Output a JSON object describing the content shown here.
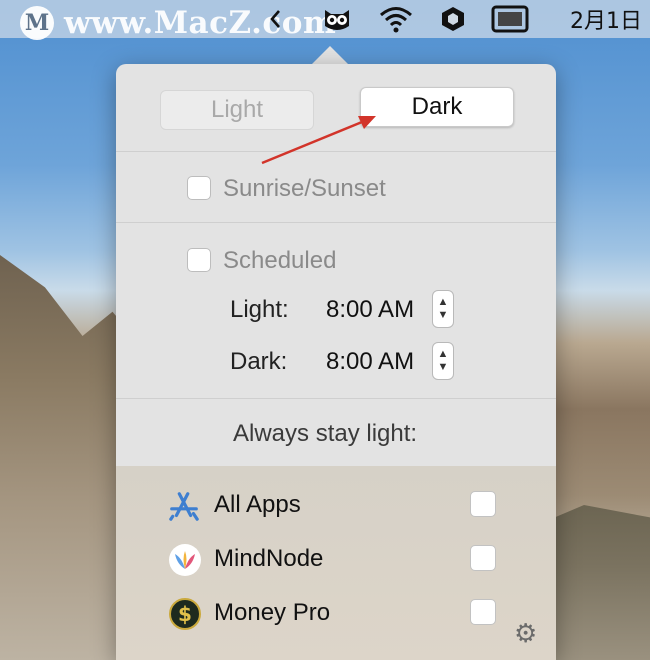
{
  "watermark": {
    "logo": "M",
    "text": "www.MacZ.com"
  },
  "menubar": {
    "icons": [
      "chevron-left-icon",
      "owl-icon",
      "wifi-icon",
      "hexagon-icon",
      "display-icon"
    ],
    "clock": "2月1日"
  },
  "popover": {
    "light_button": "Light",
    "dark_button": "Dark",
    "sunrise_label": "Sunrise/Sunset",
    "scheduled_label": "Scheduled",
    "light_time_label": "Light:",
    "light_time_value": "8:00 AM",
    "dark_time_label": "Dark:",
    "dark_time_value": "8:00 AM",
    "always_light_label": "Always stay light:",
    "apps": [
      {
        "name": "All Apps",
        "icon": "app-store-icon"
      },
      {
        "name": "MindNode",
        "icon": "mindnode-icon"
      },
      {
        "name": "Money Pro",
        "icon": "money-pro-icon"
      }
    ]
  },
  "colors": {
    "annotation_arrow": "#d2342a",
    "popover_bg": "#e3e3e3"
  }
}
